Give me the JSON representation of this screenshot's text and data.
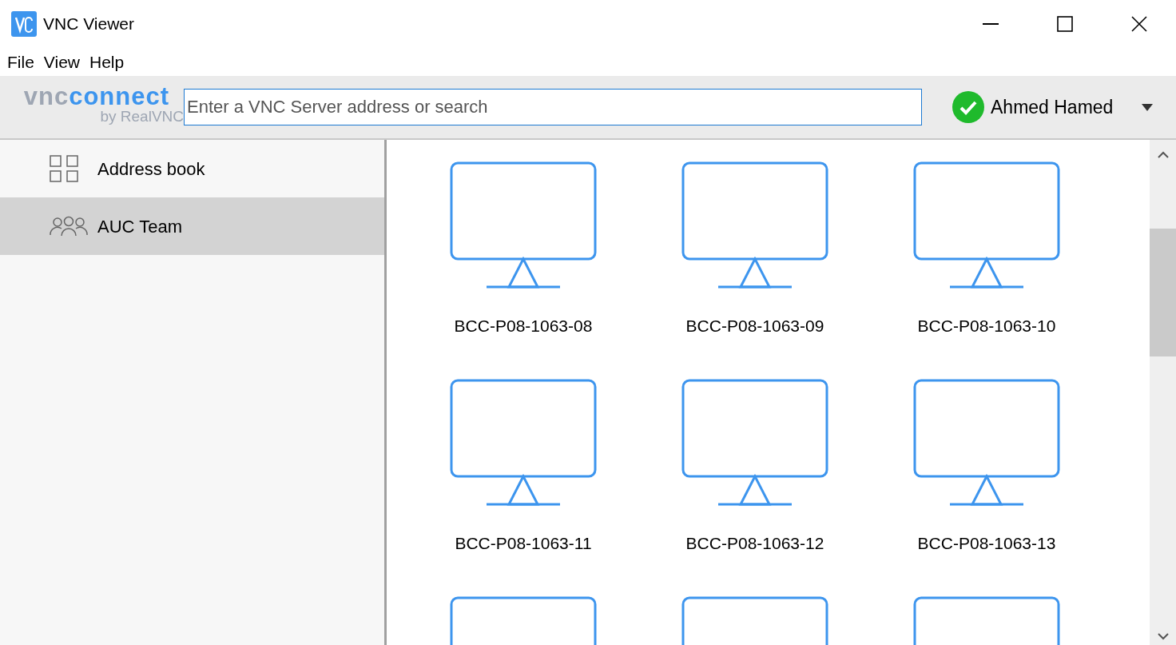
{
  "window": {
    "title": "VNC Viewer"
  },
  "menu": [
    "File",
    "View",
    "Help"
  ],
  "toolbar": {
    "logo": {
      "brand": "vnc",
      "product": "connect",
      "byline": "by RealVNC"
    },
    "search": {
      "placeholder": "Enter a VNC Server address or search",
      "focused": true
    },
    "user": {
      "name": "Ahmed Hamed",
      "signed_in": true
    }
  },
  "sidebar": {
    "items": [
      {
        "label": "Address book",
        "kind": "grid",
        "selected": false
      },
      {
        "label": "AUC Team",
        "kind": "team",
        "selected": true
      }
    ]
  },
  "computers": [
    {
      "kind": "computer",
      "name": "BCC-P08-1063-08"
    },
    {
      "kind": "computer",
      "name": "BCC-P08-1063-09"
    },
    {
      "kind": "computer",
      "name": "BCC-P08-1063-10"
    },
    {
      "kind": "computer",
      "name": "BCC-P08-1063-11"
    },
    {
      "kind": "computer",
      "name": "BCC-P08-1063-12"
    },
    {
      "kind": "computer",
      "name": "BCC-P08-1063-13"
    },
    {
      "kind": "cut_off"
    },
    {
      "kind": "cut_off"
    },
    {
      "kind": "cut_off"
    }
  ]
}
